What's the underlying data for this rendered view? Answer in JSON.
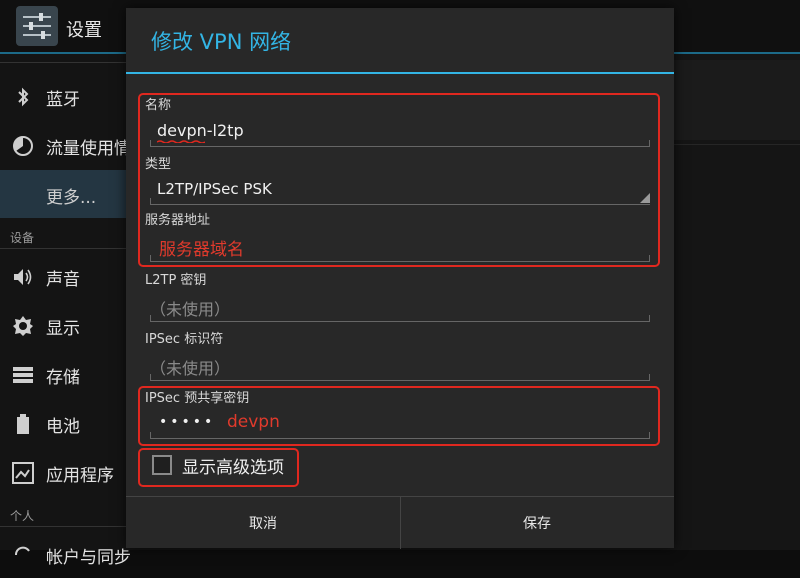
{
  "app": {
    "title": "设置",
    "icon": "settings-sliders-icon"
  },
  "sidebar": {
    "items": [
      {
        "label": "蓝牙",
        "icon": "bluetooth-icon"
      },
      {
        "label": "流量使用情",
        "icon": "data-usage-icon"
      },
      {
        "label": "更多...",
        "icon": "",
        "selected": true
      },
      {
        "label": "声音",
        "icon": "speaker-icon"
      },
      {
        "label": "显示",
        "icon": "brightness-icon"
      },
      {
        "label": "存储",
        "icon": "storage-icon"
      },
      {
        "label": "电池",
        "icon": "battery-icon"
      },
      {
        "label": "应用程序",
        "icon": "apps-icon"
      },
      {
        "label": "帐户与同步",
        "icon": "sync-icon"
      }
    ],
    "sections": {
      "device": "设备",
      "personal": "个人"
    }
  },
  "dialog": {
    "title": "修改 VPN 网络",
    "fields": {
      "name": {
        "label": "名称",
        "value": "devpn-l2tp"
      },
      "type": {
        "label": "类型",
        "value": "L2TP/IPSec PSK"
      },
      "server": {
        "label": "服务器地址",
        "value": "服务器域名"
      },
      "l2tp_secret": {
        "label": "L2TP 密钥",
        "value": "（未使用）"
      },
      "ipsec_id": {
        "label": "IPSec 标识符",
        "value": "（未使用）"
      },
      "ipsec_psk": {
        "label": "IPSec 预共享密钥",
        "masked": "•••••",
        "note": "devpn"
      }
    },
    "advanced_checkbox": {
      "label": "显示高级选项",
      "checked": false
    },
    "buttons": {
      "cancel": "取消",
      "save": "保存"
    }
  },
  "colors": {
    "accent": "#33b5e5",
    "annotation": "#e0281f"
  }
}
